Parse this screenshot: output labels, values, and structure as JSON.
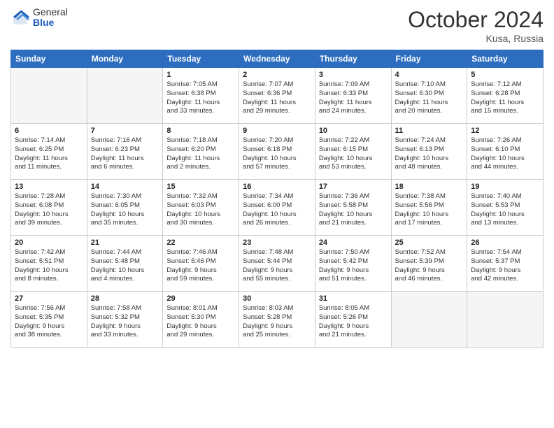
{
  "header": {
    "logo_general": "General",
    "logo_blue": "Blue",
    "month_title": "October 2024",
    "location": "Kusa, Russia"
  },
  "days_of_week": [
    "Sunday",
    "Monday",
    "Tuesday",
    "Wednesday",
    "Thursday",
    "Friday",
    "Saturday"
  ],
  "weeks": [
    [
      {
        "day": "",
        "lines": []
      },
      {
        "day": "",
        "lines": []
      },
      {
        "day": "1",
        "lines": [
          "Sunrise: 7:05 AM",
          "Sunset: 6:38 PM",
          "Daylight: 11 hours",
          "and 33 minutes."
        ]
      },
      {
        "day": "2",
        "lines": [
          "Sunrise: 7:07 AM",
          "Sunset: 6:36 PM",
          "Daylight: 11 hours",
          "and 29 minutes."
        ]
      },
      {
        "day": "3",
        "lines": [
          "Sunrise: 7:09 AM",
          "Sunset: 6:33 PM",
          "Daylight: 11 hours",
          "and 24 minutes."
        ]
      },
      {
        "day": "4",
        "lines": [
          "Sunrise: 7:10 AM",
          "Sunset: 6:30 PM",
          "Daylight: 11 hours",
          "and 20 minutes."
        ]
      },
      {
        "day": "5",
        "lines": [
          "Sunrise: 7:12 AM",
          "Sunset: 6:28 PM",
          "Daylight: 11 hours",
          "and 15 minutes."
        ]
      }
    ],
    [
      {
        "day": "6",
        "lines": [
          "Sunrise: 7:14 AM",
          "Sunset: 6:25 PM",
          "Daylight: 11 hours",
          "and 11 minutes."
        ]
      },
      {
        "day": "7",
        "lines": [
          "Sunrise: 7:16 AM",
          "Sunset: 6:23 PM",
          "Daylight: 11 hours",
          "and 6 minutes."
        ]
      },
      {
        "day": "8",
        "lines": [
          "Sunrise: 7:18 AM",
          "Sunset: 6:20 PM",
          "Daylight: 11 hours",
          "and 2 minutes."
        ]
      },
      {
        "day": "9",
        "lines": [
          "Sunrise: 7:20 AM",
          "Sunset: 6:18 PM",
          "Daylight: 10 hours",
          "and 57 minutes."
        ]
      },
      {
        "day": "10",
        "lines": [
          "Sunrise: 7:22 AM",
          "Sunset: 6:15 PM",
          "Daylight: 10 hours",
          "and 53 minutes."
        ]
      },
      {
        "day": "11",
        "lines": [
          "Sunrise: 7:24 AM",
          "Sunset: 6:13 PM",
          "Daylight: 10 hours",
          "and 48 minutes."
        ]
      },
      {
        "day": "12",
        "lines": [
          "Sunrise: 7:26 AM",
          "Sunset: 6:10 PM",
          "Daylight: 10 hours",
          "and 44 minutes."
        ]
      }
    ],
    [
      {
        "day": "13",
        "lines": [
          "Sunrise: 7:28 AM",
          "Sunset: 6:08 PM",
          "Daylight: 10 hours",
          "and 39 minutes."
        ]
      },
      {
        "day": "14",
        "lines": [
          "Sunrise: 7:30 AM",
          "Sunset: 6:05 PM",
          "Daylight: 10 hours",
          "and 35 minutes."
        ]
      },
      {
        "day": "15",
        "lines": [
          "Sunrise: 7:32 AM",
          "Sunset: 6:03 PM",
          "Daylight: 10 hours",
          "and 30 minutes."
        ]
      },
      {
        "day": "16",
        "lines": [
          "Sunrise: 7:34 AM",
          "Sunset: 6:00 PM",
          "Daylight: 10 hours",
          "and 26 minutes."
        ]
      },
      {
        "day": "17",
        "lines": [
          "Sunrise: 7:36 AM",
          "Sunset: 5:58 PM",
          "Daylight: 10 hours",
          "and 21 minutes."
        ]
      },
      {
        "day": "18",
        "lines": [
          "Sunrise: 7:38 AM",
          "Sunset: 5:56 PM",
          "Daylight: 10 hours",
          "and 17 minutes."
        ]
      },
      {
        "day": "19",
        "lines": [
          "Sunrise: 7:40 AM",
          "Sunset: 5:53 PM",
          "Daylight: 10 hours",
          "and 13 minutes."
        ]
      }
    ],
    [
      {
        "day": "20",
        "lines": [
          "Sunrise: 7:42 AM",
          "Sunset: 5:51 PM",
          "Daylight: 10 hours",
          "and 8 minutes."
        ]
      },
      {
        "day": "21",
        "lines": [
          "Sunrise: 7:44 AM",
          "Sunset: 5:48 PM",
          "Daylight: 10 hours",
          "and 4 minutes."
        ]
      },
      {
        "day": "22",
        "lines": [
          "Sunrise: 7:46 AM",
          "Sunset: 5:46 PM",
          "Daylight: 9 hours",
          "and 59 minutes."
        ]
      },
      {
        "day": "23",
        "lines": [
          "Sunrise: 7:48 AM",
          "Sunset: 5:44 PM",
          "Daylight: 9 hours",
          "and 55 minutes."
        ]
      },
      {
        "day": "24",
        "lines": [
          "Sunrise: 7:50 AM",
          "Sunset: 5:42 PM",
          "Daylight: 9 hours",
          "and 51 minutes."
        ]
      },
      {
        "day": "25",
        "lines": [
          "Sunrise: 7:52 AM",
          "Sunset: 5:39 PM",
          "Daylight: 9 hours",
          "and 46 minutes."
        ]
      },
      {
        "day": "26",
        "lines": [
          "Sunrise: 7:54 AM",
          "Sunset: 5:37 PM",
          "Daylight: 9 hours",
          "and 42 minutes."
        ]
      }
    ],
    [
      {
        "day": "27",
        "lines": [
          "Sunrise: 7:56 AM",
          "Sunset: 5:35 PM",
          "Daylight: 9 hours",
          "and 38 minutes."
        ]
      },
      {
        "day": "28",
        "lines": [
          "Sunrise: 7:58 AM",
          "Sunset: 5:32 PM",
          "Daylight: 9 hours",
          "and 33 minutes."
        ]
      },
      {
        "day": "29",
        "lines": [
          "Sunrise: 8:01 AM",
          "Sunset: 5:30 PM",
          "Daylight: 9 hours",
          "and 29 minutes."
        ]
      },
      {
        "day": "30",
        "lines": [
          "Sunrise: 8:03 AM",
          "Sunset: 5:28 PM",
          "Daylight: 9 hours",
          "and 25 minutes."
        ]
      },
      {
        "day": "31",
        "lines": [
          "Sunrise: 8:05 AM",
          "Sunset: 5:26 PM",
          "Daylight: 9 hours",
          "and 21 minutes."
        ]
      },
      {
        "day": "",
        "lines": []
      },
      {
        "day": "",
        "lines": []
      }
    ]
  ]
}
